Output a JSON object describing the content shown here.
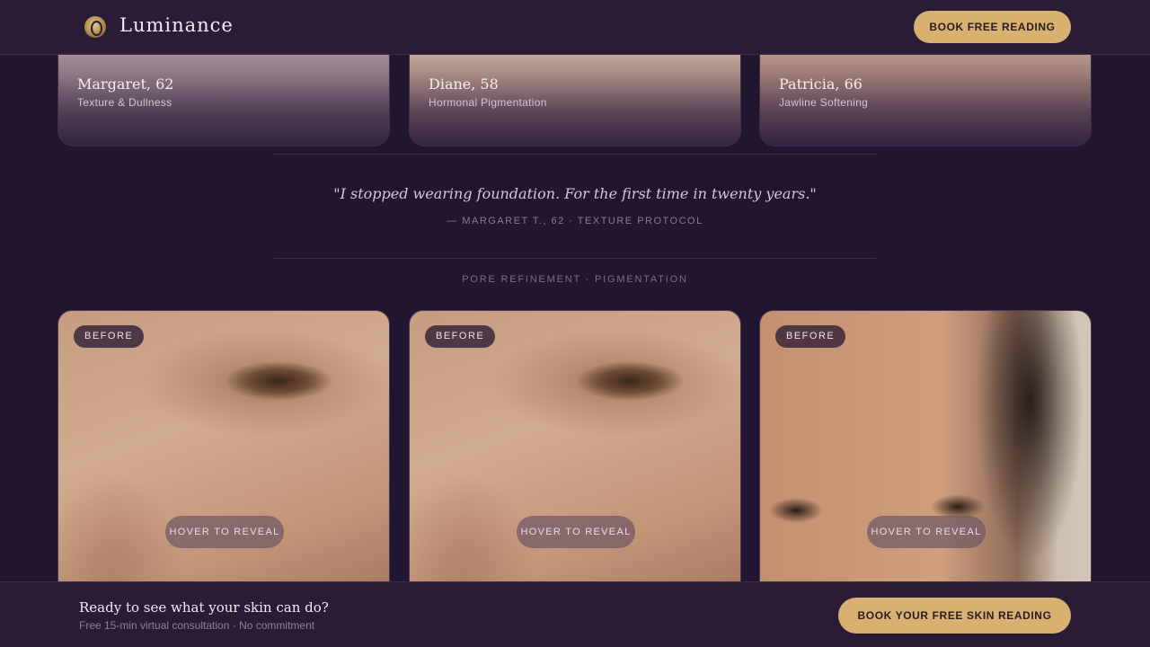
{
  "header": {
    "brand": "Luminance",
    "cta": "BOOK FREE READING"
  },
  "testimonials": [
    {
      "name": "Margaret, 62",
      "concern": "Texture & Dullness"
    },
    {
      "name": "Diane, 58",
      "concern": "Hormonal Pigmentation"
    },
    {
      "name": "Patricia, 66",
      "concern": "Jawline Softening"
    }
  ],
  "quote": {
    "text": "\"I stopped wearing foundation. For the first time in twenty years.\"",
    "attribution": "— MARGARET T., 62 · TEXTURE PROTOCOL"
  },
  "section": {
    "label": "PORE REFINEMENT · PIGMENTATION"
  },
  "comparisons": [
    {
      "badge": "BEFORE",
      "hint": "HOVER TO REVEAL"
    },
    {
      "badge": "BEFORE",
      "hint": "HOVER TO REVEAL"
    },
    {
      "badge": "BEFORE",
      "hint": "HOVER TO REVEAL"
    }
  ],
  "footer_cta": {
    "title": "Ready to see what your skin can do?",
    "subtitle": "Free 15-min virtual consultation · No commitment",
    "button": "BOOK YOUR FREE SKIN READING"
  },
  "colors": {
    "background": "#221530",
    "accent_gold": "#d8b070",
    "bar": "#2a1c36"
  },
  "icons": {
    "logo": "luminance-logo-icon"
  }
}
